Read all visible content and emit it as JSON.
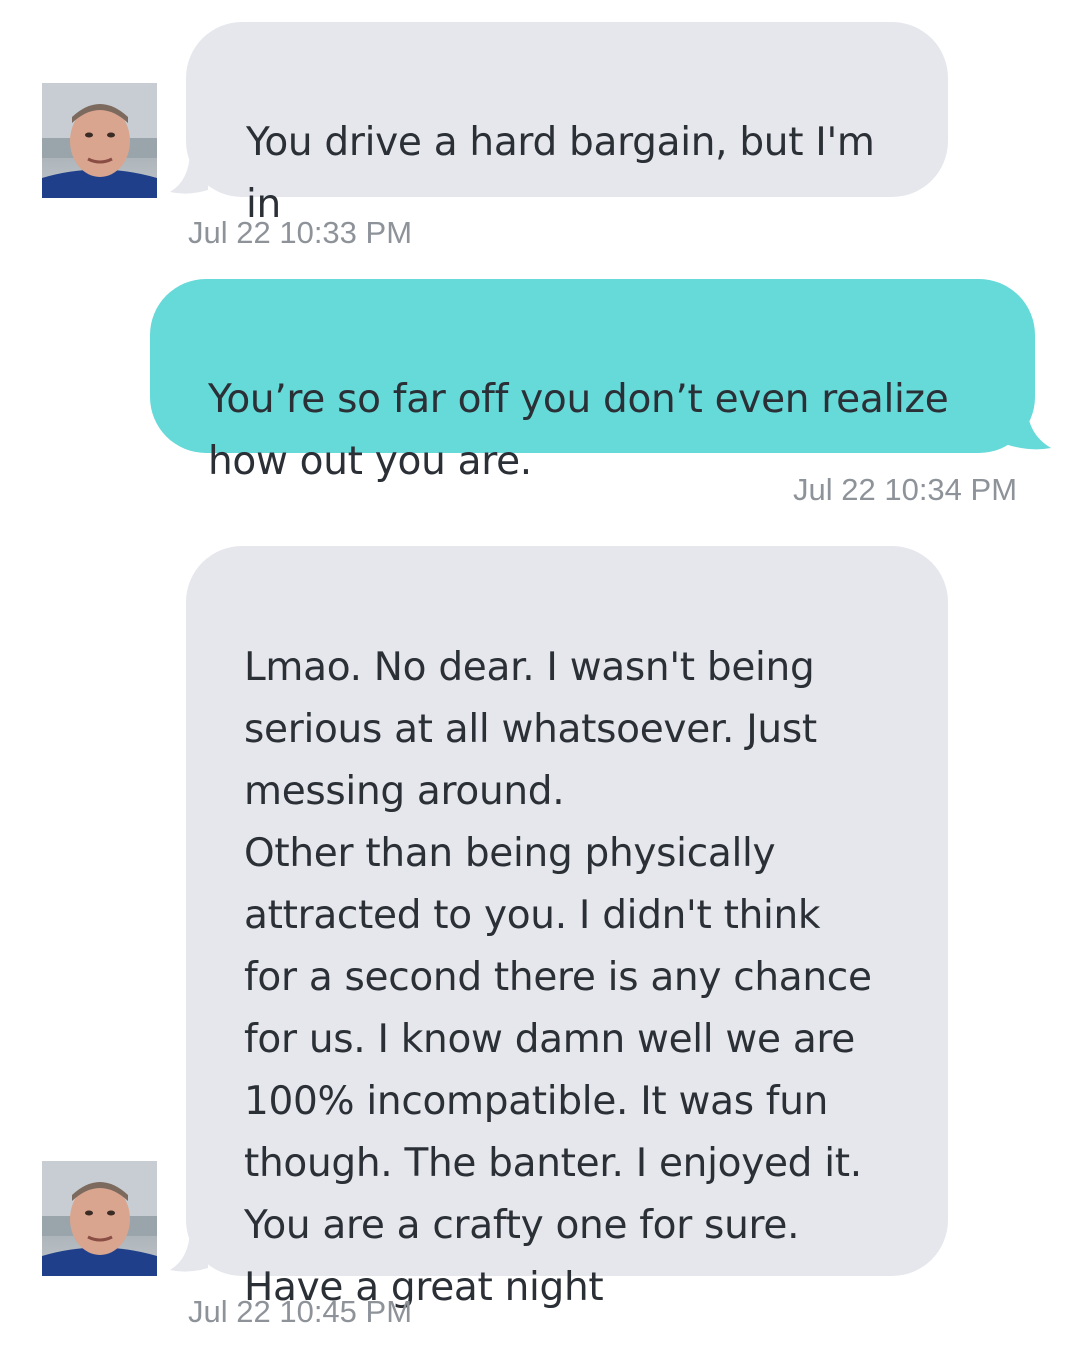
{
  "colors": {
    "incoming_bubble": "#e5e7ec",
    "outgoing_bubble": "#66d9d9",
    "timestamp": "#8e939a",
    "text": "#2b2f36"
  },
  "messages": [
    {
      "direction": "incoming",
      "avatar": "user-avatar-photo",
      "text": "You drive a hard bargain, but I'm\nin",
      "timestamp": "Jul 22 10:33 PM"
    },
    {
      "direction": "outgoing",
      "text": "You’re so far off you don’t even realize\nhow out you are.",
      "timestamp": "Jul 22 10:34 PM"
    },
    {
      "direction": "incoming",
      "avatar": "user-avatar-photo",
      "text": "Lmao. No dear. I wasn't being\nserious at all whatsoever. Just\nmessing around.\nOther than being physically\nattracted to you. I didn't think\nfor a second there is any chance\nfor us. I know damn well we are\n100% incompatible. It was fun\nthough. The banter. I enjoyed it.\nYou are a crafty one for sure.\nHave a great night",
      "timestamp": "Jul 22 10:45 PM"
    }
  ]
}
